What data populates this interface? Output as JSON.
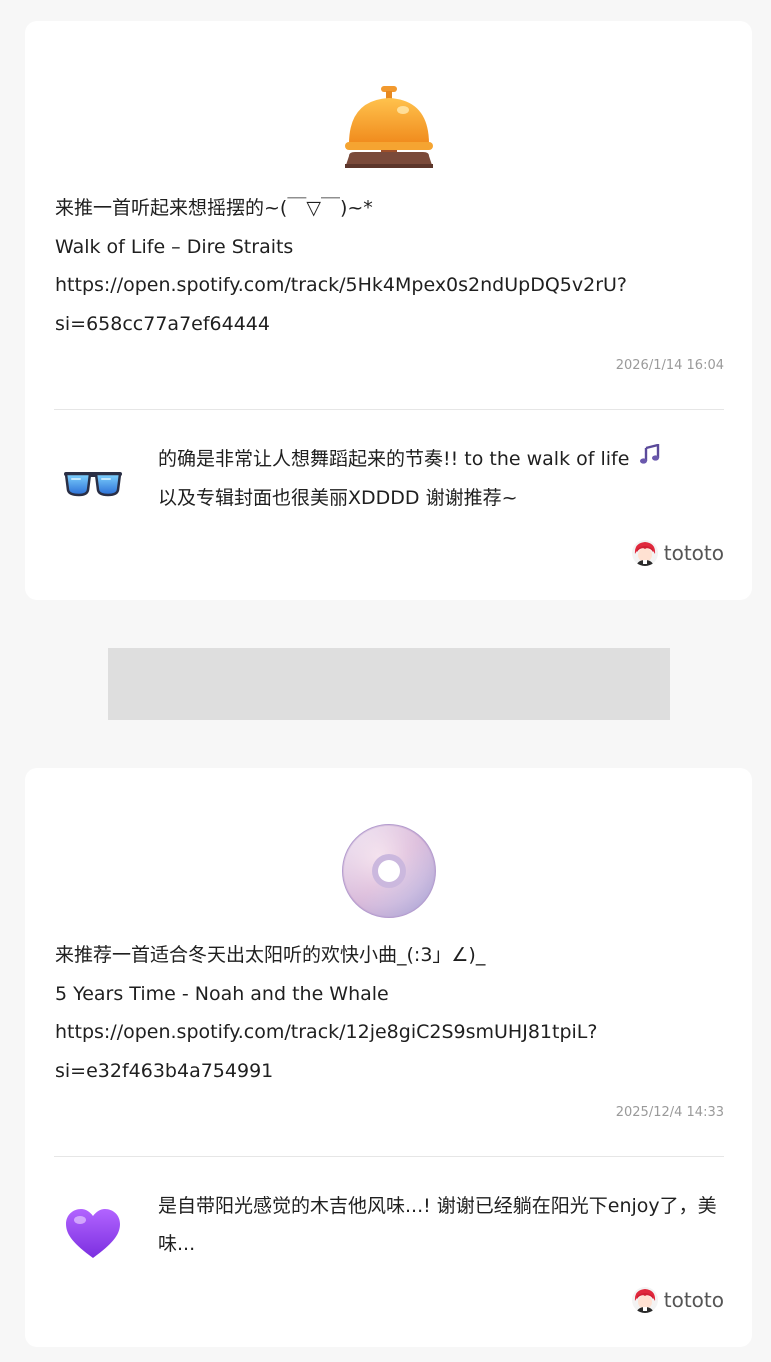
{
  "posts": [
    {
      "icon": "bellhop-bell-icon",
      "lines": [
        "来推一首听起来想摇摆的~(￣▽￣)~*",
        "Walk of Life – Dire Straits",
        "https://open.spotify.com/track/5Hk4Mpex0s2ndUpDQ5v2rU?",
        "si=658cc77a7ef64444"
      ],
      "timestamp": "2026/1/14 16:04",
      "reply": {
        "icon": "sunglasses-icon",
        "text": "的确是非常让人想舞蹈起来的节奏!! to the walk of life 🎶 以及专辑封面也很美丽XDDDD 谢谢推荐~",
        "lines": [
          "的确是非常让人想舞蹈起来的节奏!! to the walk of life",
          "以及专辑封面也很美丽XDDDD 谢谢推荐~"
        ],
        "inline_icon": "music-notes-icon"
      },
      "author": "tototo"
    },
    {
      "icon": "compact-disc-icon",
      "lines": [
        "来推荐一首适合冬天出太阳听的欢快小曲_(:3」∠)_",
        "5 Years Time - Noah and the Whale",
        "https://open.spotify.com/track/12je8giC2S9smUHJ81tpiL?",
        "si=e32f463b4a754991"
      ],
      "timestamp": "2025/12/4 14:33",
      "reply": {
        "icon": "purple-heart-icon",
        "lines": [
          "是自带阳光感觉的木吉他风味...! 谢谢已经躺在阳光下enjoy了，美",
          "味..."
        ]
      },
      "author": "tototo"
    }
  ],
  "colors": {
    "card_background": "#ffffff",
    "page_background": "#f7f7f7",
    "ad_placeholder": "#dedede",
    "timestamp": "#9a9a9a"
  }
}
